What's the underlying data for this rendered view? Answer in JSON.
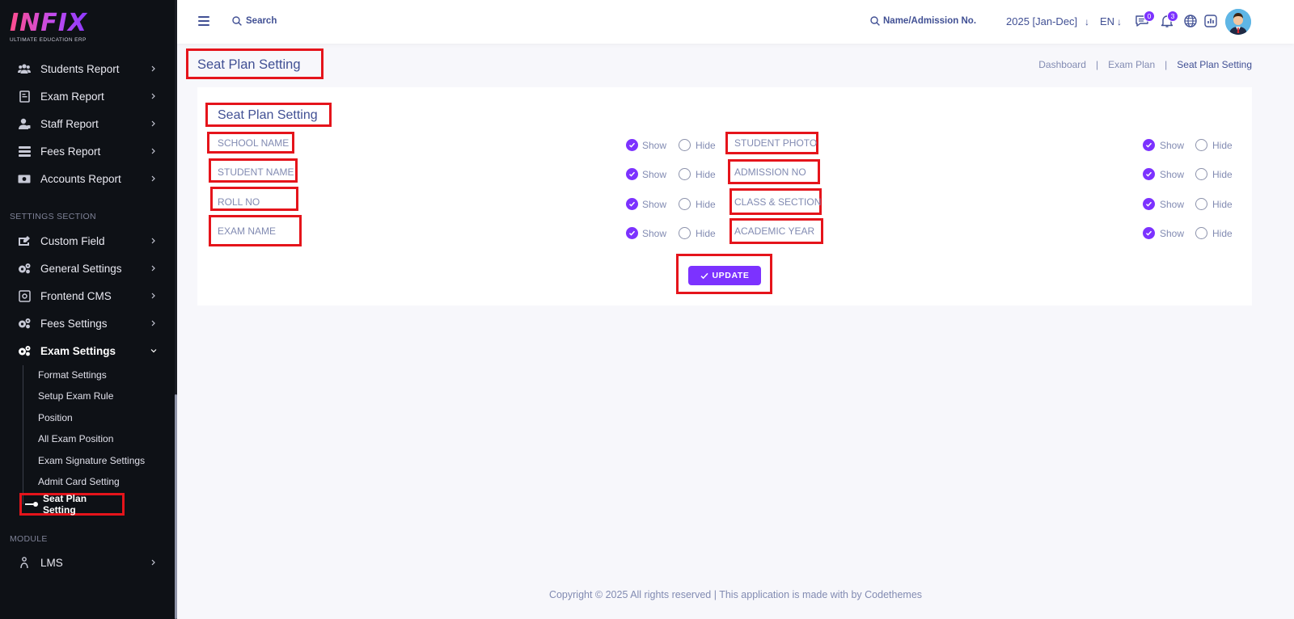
{
  "logo": {
    "text": "INFIX",
    "subtitle": "ULTIMATE EDUCATION ERP"
  },
  "sidebar": {
    "report_items": [
      {
        "label": "Students Report",
        "icon": "users-icon"
      },
      {
        "label": "Exam Report",
        "icon": "document-icon"
      },
      {
        "label": "Staff Report",
        "icon": "user-icon"
      },
      {
        "label": "Fees Report",
        "icon": "list-icon"
      },
      {
        "label": "Accounts Report",
        "icon": "money-icon"
      }
    ],
    "settings_section_title": "SETTINGS SECTION",
    "settings_items": [
      {
        "label": "Custom Field",
        "icon": "custom-field-icon"
      },
      {
        "label": "General Settings",
        "icon": "gears-icon"
      },
      {
        "label": "Frontend CMS",
        "icon": "cms-icon"
      },
      {
        "label": "Fees Settings",
        "icon": "gears-icon"
      },
      {
        "label": "Exam Settings",
        "icon": "gears-icon"
      }
    ],
    "exam_sub_items": [
      "Format Settings",
      "Setup Exam Rule",
      "Position",
      "All Exam Position",
      "Exam Signature Settings",
      "Admit Card Setting"
    ],
    "current_sub_item": "Seat Plan Setting",
    "module_section_title": "MODULE",
    "module_items": [
      {
        "label": "LMS",
        "icon": "lms-icon"
      }
    ]
  },
  "header": {
    "search_label": "Search",
    "admission_search_label": "Name/Admission No.",
    "academic_year": "2025 [Jan-Dec]",
    "language": "EN",
    "chat_badge": "0",
    "notification_badge": "3"
  },
  "page": {
    "title": "Seat Plan Setting",
    "breadcrumb": [
      "Dashboard",
      "Exam Plan",
      "Seat Plan Setting"
    ],
    "separator": "|"
  },
  "card": {
    "title": "Seat Plan Setting",
    "show_label": "Show",
    "hide_label": "Hide",
    "left_fields": [
      {
        "label": "SCHOOL NAME",
        "value": "show"
      },
      {
        "label": "STUDENT NAME",
        "value": "show"
      },
      {
        "label": "ROLL NO",
        "value": "show"
      },
      {
        "label": "EXAM NAME",
        "value": "show"
      }
    ],
    "right_fields": [
      {
        "label": "STUDENT PHOTO",
        "value": "show"
      },
      {
        "label": "ADMISSION NO",
        "value": "show"
      },
      {
        "label": "CLASS & SECTION",
        "value": "show"
      },
      {
        "label": "ACADEMIC YEAR",
        "value": "show"
      }
    ],
    "update_label": "UPDATE"
  },
  "footer": {
    "text": "Copyright © 2025 All rights reserved | This application is made with by Codethemes"
  },
  "colors": {
    "accent": "#7c32ff",
    "highlight": "#e5141b",
    "sidebar_bg": "#0e1116",
    "text_primary": "#415094"
  }
}
